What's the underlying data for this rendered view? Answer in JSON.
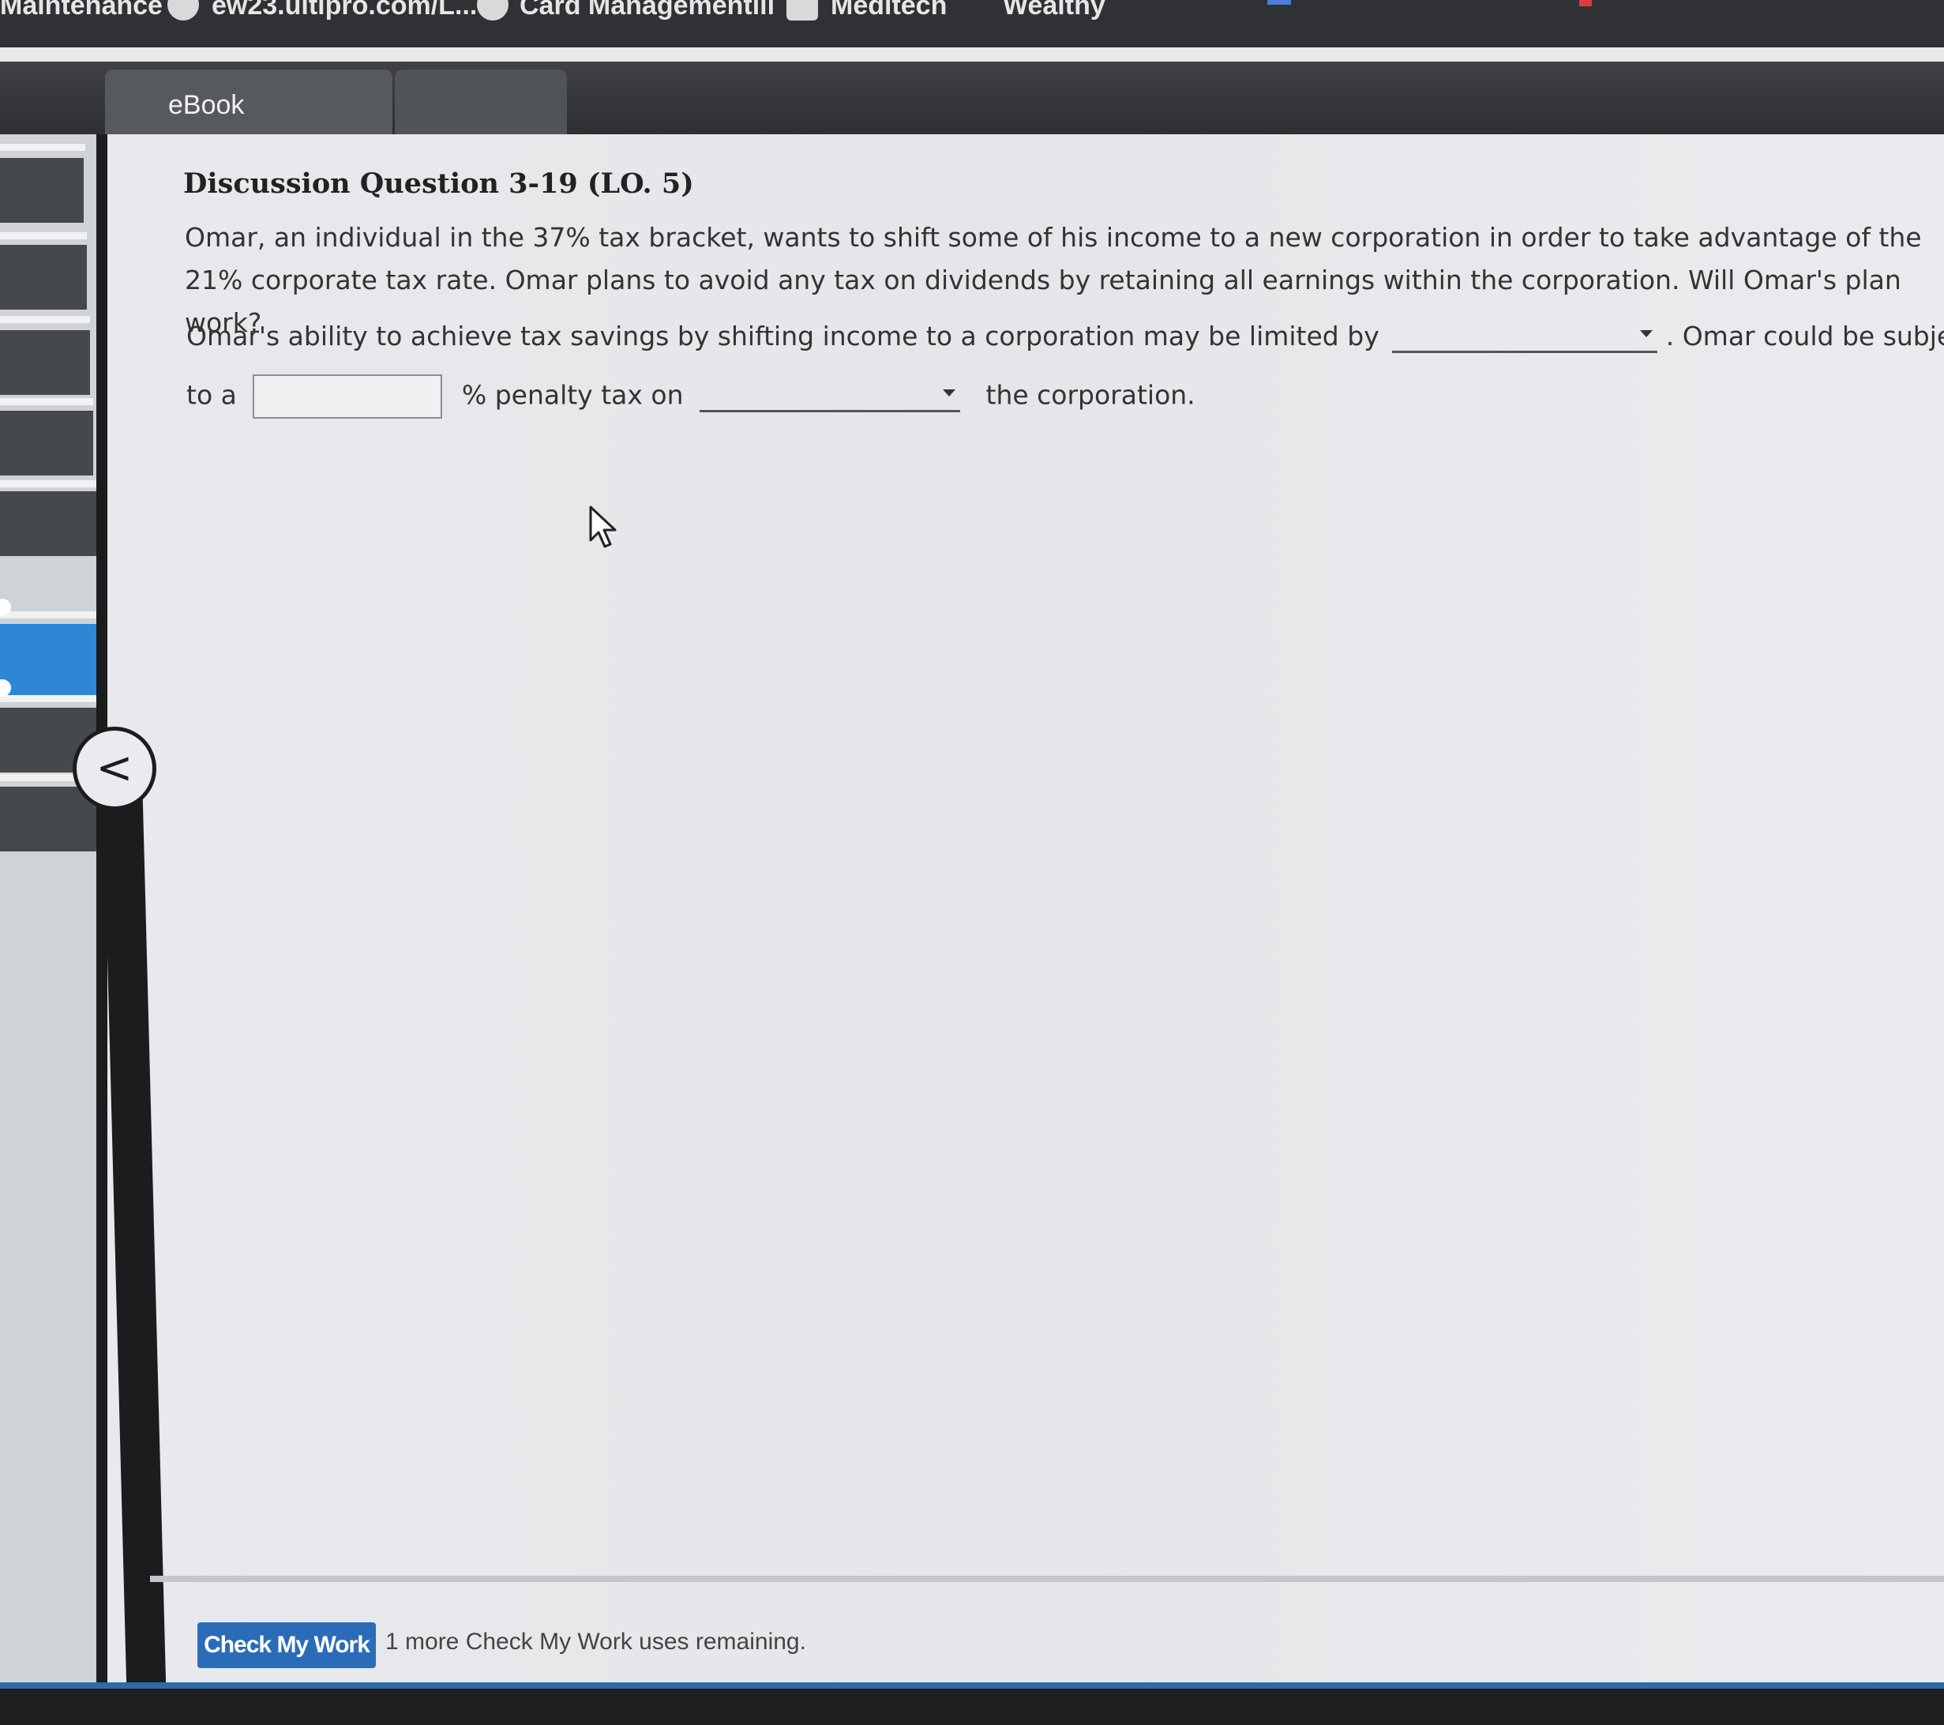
{
  "bookmarks": [
    {
      "label": "Maintenance"
    },
    {
      "label": "ew23.ultipro.com/L..."
    },
    {
      "label": "Card Managementlii"
    },
    {
      "label": "Meditech"
    },
    {
      "label": "Wealthy"
    }
  ],
  "tabs": [
    {
      "label": "eBook"
    },
    {
      "label": ""
    }
  ],
  "nav": {
    "collapse_glyph": "<"
  },
  "question": {
    "title": "Discussion Question 3-19 (LO. 5)",
    "text": "Omar, an individual in the 37% tax bracket, wants to shift some of his income to a new corporation in order to take advantage of the 21% corporate tax rate. Omar plans to avoid any tax on dividends by retaining all earnings within the corporation. Will Omar's plan work?",
    "row1_prefix": "Omar's ability to achieve tax savings by shifting income to a corporation may be limited by",
    "row1_suffix": ". Omar could be subject",
    "row2_prefix": "to a",
    "row2_middle": "% penalty tax on",
    "row2_suffix": "the corporation.",
    "select1_value": "",
    "input_value": "",
    "select2_value": ""
  },
  "footer": {
    "check_button": "Check My Work",
    "check_note": "1 more Check My Work uses remaining."
  }
}
